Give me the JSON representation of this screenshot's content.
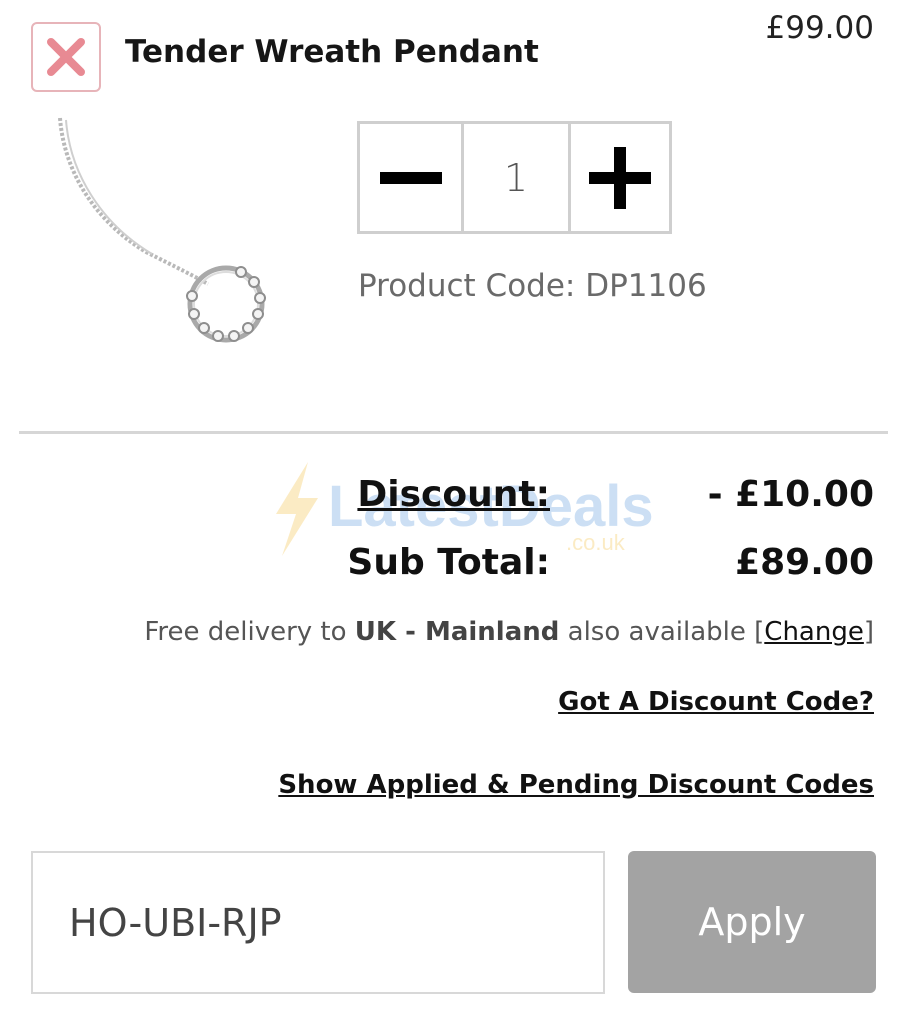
{
  "product": {
    "title": "Tender Wreath Pendant",
    "price": "£99.00",
    "quantity": "1",
    "code_label": "Product Code:",
    "code": "DP1106"
  },
  "icons": {
    "remove": "close-x-icon",
    "minus": "minus-icon",
    "plus": "plus-icon"
  },
  "summary": {
    "discount_label": "Discount:",
    "discount_value": "- £10.00",
    "subtotal_label": "Sub Total:",
    "subtotal_value": "£89.00"
  },
  "delivery": {
    "prefix": "Free delivery to",
    "region": "UK - Mainland",
    "suffix": "also available",
    "open_bracket": "[",
    "change_link": "Change",
    "close_bracket": "]"
  },
  "links": {
    "got_discount_code": "Got A Discount Code?",
    "show_codes": "Show Applied & Pending Discount Codes"
  },
  "discount_form": {
    "input_value": "HO-UBI-RJP",
    "apply_label": "Apply"
  },
  "watermark": {
    "brand": "LatestDeals",
    "domain": ".co.uk"
  },
  "colors": {
    "remove_border": "#e7b4b9",
    "remove_x": "#e88a93",
    "apply_bg": "#a3a3a3",
    "divider": "#d6d6d6"
  }
}
